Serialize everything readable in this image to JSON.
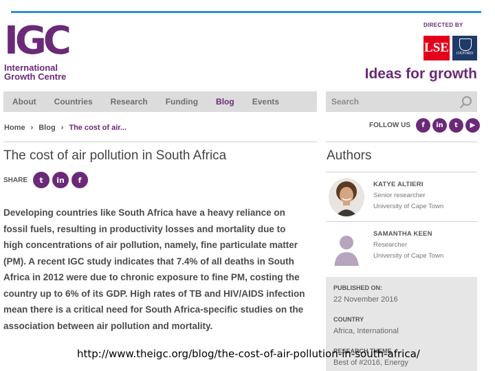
{
  "logo": {
    "mark": "IGC",
    "line1": "International",
    "line2": "Growth Centre"
  },
  "partners": {
    "directed_by": "DIRECTED BY",
    "lse": "LSE",
    "oxford": "OXFORD"
  },
  "tagline": "Ideas for growth",
  "nav": {
    "items": [
      "About",
      "Countries",
      "Research",
      "Funding",
      "Blog",
      "Events"
    ],
    "active": "Blog"
  },
  "search": {
    "placeholder": "Search"
  },
  "breadcrumb": {
    "items": [
      "Home",
      "Blog",
      "The cost of air..."
    ],
    "separator": "›"
  },
  "follow": {
    "label": "FOLLOW US",
    "icons": [
      "facebook-icon",
      "linkedin-icon",
      "twitter-icon",
      "youtube-icon"
    ]
  },
  "article": {
    "title": "The cost of air pollution in South Africa",
    "share_label": "SHARE",
    "share_icons": [
      "twitter-icon",
      "linkedin-icon",
      "facebook-icon"
    ],
    "body": "Developing countries like South Africa have a heavy reliance on fossil fuels, resulting in productivity losses and mortality due to high concentrations of air pollution, namely, fine particulate matter (PM). A recent IGC study indicates that 7.4% of all deaths in South Africa in 2012 were due to chronic exposure to fine PM, costing the country up to 6% of its GDP. High rates of TB and HIV/AIDS infection mean there is a critical need for South Africa-specific studies on the association between air pollution and mortality."
  },
  "authors": {
    "heading": "Authors",
    "list": [
      {
        "name": "KATYE ALTIERI",
        "role": "Senior researcher",
        "org": "University of Cape Town"
      },
      {
        "name": "SAMANTHA KEEN",
        "role": "Researcher",
        "org": "University of Cape Town"
      }
    ]
  },
  "meta": {
    "published_label": "PUBLISHED ON:",
    "published_value": "22 November 2016",
    "country_label": "COUNTRY",
    "country_value": "Africa, International",
    "theme_label": "RESEARCH THEME",
    "theme_value": "Best of #2016, Energy"
  },
  "caption_url": "http://www.theigc.org/blog/the-cost-of-air-pollution-in-south-africa/",
  "colors": {
    "brand": "#6a2a78",
    "accent_line": "#2d8fd5",
    "lse_red": "#e3001b",
    "oxford_blue": "#1f3a68",
    "nav_bg": "#dcdcdc"
  }
}
